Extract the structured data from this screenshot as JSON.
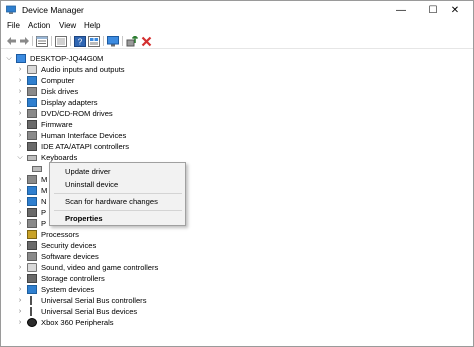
{
  "window": {
    "title": "Device Manager",
    "minimize_glyph": "—",
    "maximize_glyph": "☐",
    "close_glyph": "✕"
  },
  "menu": [
    "File",
    "Action",
    "View",
    "Help"
  ],
  "toolbar": {
    "icons": [
      "back-icon",
      "forward-icon",
      "properties-icon",
      "show-hidden-icon",
      "help-icon",
      "view-icon",
      "monitor-icon",
      "update-driver-icon",
      "uninstall-icon"
    ],
    "accent": "#2e7d32",
    "danger": "#d32f2f"
  },
  "tree": {
    "root": "DESKTOP-JQ44G0M",
    "categories": [
      {
        "label": "Audio inputs and outputs",
        "icon": "speaker-icon"
      },
      {
        "label": "Computer",
        "icon": "computer-icon"
      },
      {
        "label": "Disk drives",
        "icon": "disk-icon"
      },
      {
        "label": "Display adapters",
        "icon": "display-icon"
      },
      {
        "label": "DVD/CD-ROM drives",
        "icon": "dvd-icon"
      },
      {
        "label": "Firmware",
        "icon": "firmware-icon"
      },
      {
        "label": "Human Interface Devices",
        "icon": "hid-icon"
      },
      {
        "label": "IDE ATA/ATAPI controllers",
        "icon": "ide-icon"
      },
      {
        "label": "Keyboards",
        "icon": "keyboard-icon"
      }
    ],
    "hidden_rows": [
      {
        "label": "M",
        "icon": "mouse-icon"
      },
      {
        "label": "M",
        "icon": "monitor-icon"
      },
      {
        "label": "N",
        "icon": "network-icon"
      },
      {
        "label": "P",
        "icon": "port-icon"
      },
      {
        "label": "P",
        "icon": "print-icon"
      }
    ],
    "lower_categories": [
      {
        "label": "Processors",
        "icon": "processor-icon"
      },
      {
        "label": "Security devices",
        "icon": "security-icon"
      },
      {
        "label": "Software devices",
        "icon": "software-icon"
      },
      {
        "label": "Sound, video and game controllers",
        "icon": "sound-icon"
      },
      {
        "label": "Storage controllers",
        "icon": "storage-icon"
      },
      {
        "label": "System devices",
        "icon": "system-icon"
      },
      {
        "label": "Universal Serial Bus controllers",
        "icon": "usb-icon"
      },
      {
        "label": "Universal Serial Bus devices",
        "icon": "usb-icon"
      },
      {
        "label": "Xbox 360 Peripherals",
        "icon": "xbox-icon"
      }
    ]
  },
  "context_menu": {
    "items": [
      "Update driver",
      "Uninstall device",
      "Scan for hardware changes",
      "Properties"
    ]
  }
}
